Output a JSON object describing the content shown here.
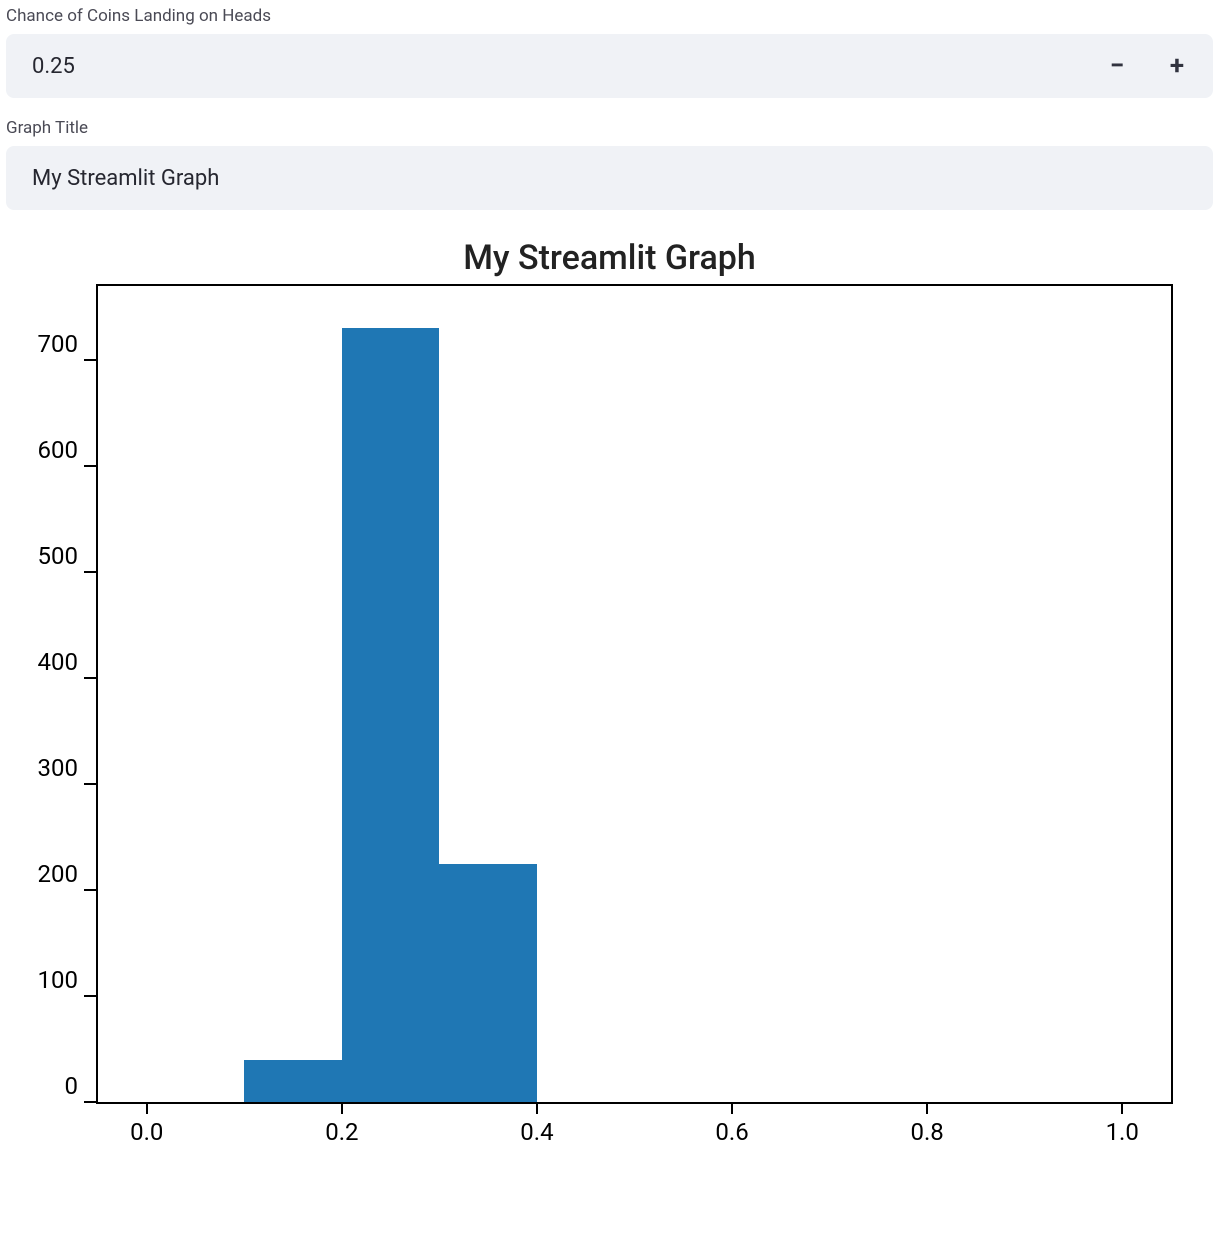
{
  "inputs": {
    "chance_label": "Chance of Coins Landing on Heads",
    "chance_value": "0.25",
    "minus_glyph": "−",
    "plus_glyph": "+",
    "title_label": "Graph Title",
    "title_value": "My Streamlit Graph"
  },
  "chart_data": {
    "type": "bar",
    "title": "My Streamlit Graph",
    "xlabel": "",
    "ylabel": "",
    "x_ticks": [
      0.0,
      0.2,
      0.4,
      0.6,
      0.8,
      1.0
    ],
    "x_tick_labels": [
      "0.0",
      "0.2",
      "0.4",
      "0.6",
      "0.8",
      "1.0"
    ],
    "xlim": [
      -0.05,
      1.05
    ],
    "y_ticks": [
      0,
      100,
      200,
      300,
      400,
      500,
      600,
      700
    ],
    "y_tick_labels": [
      "0",
      "100",
      "200",
      "300",
      "400",
      "500",
      "600",
      "700"
    ],
    "ylim": [
      0,
      770
    ],
    "bar_width": 0.1,
    "categories": [
      0.1,
      0.2,
      0.3
    ],
    "values": [
      40,
      730,
      225
    ],
    "bar_color": "#1f77b4"
  }
}
